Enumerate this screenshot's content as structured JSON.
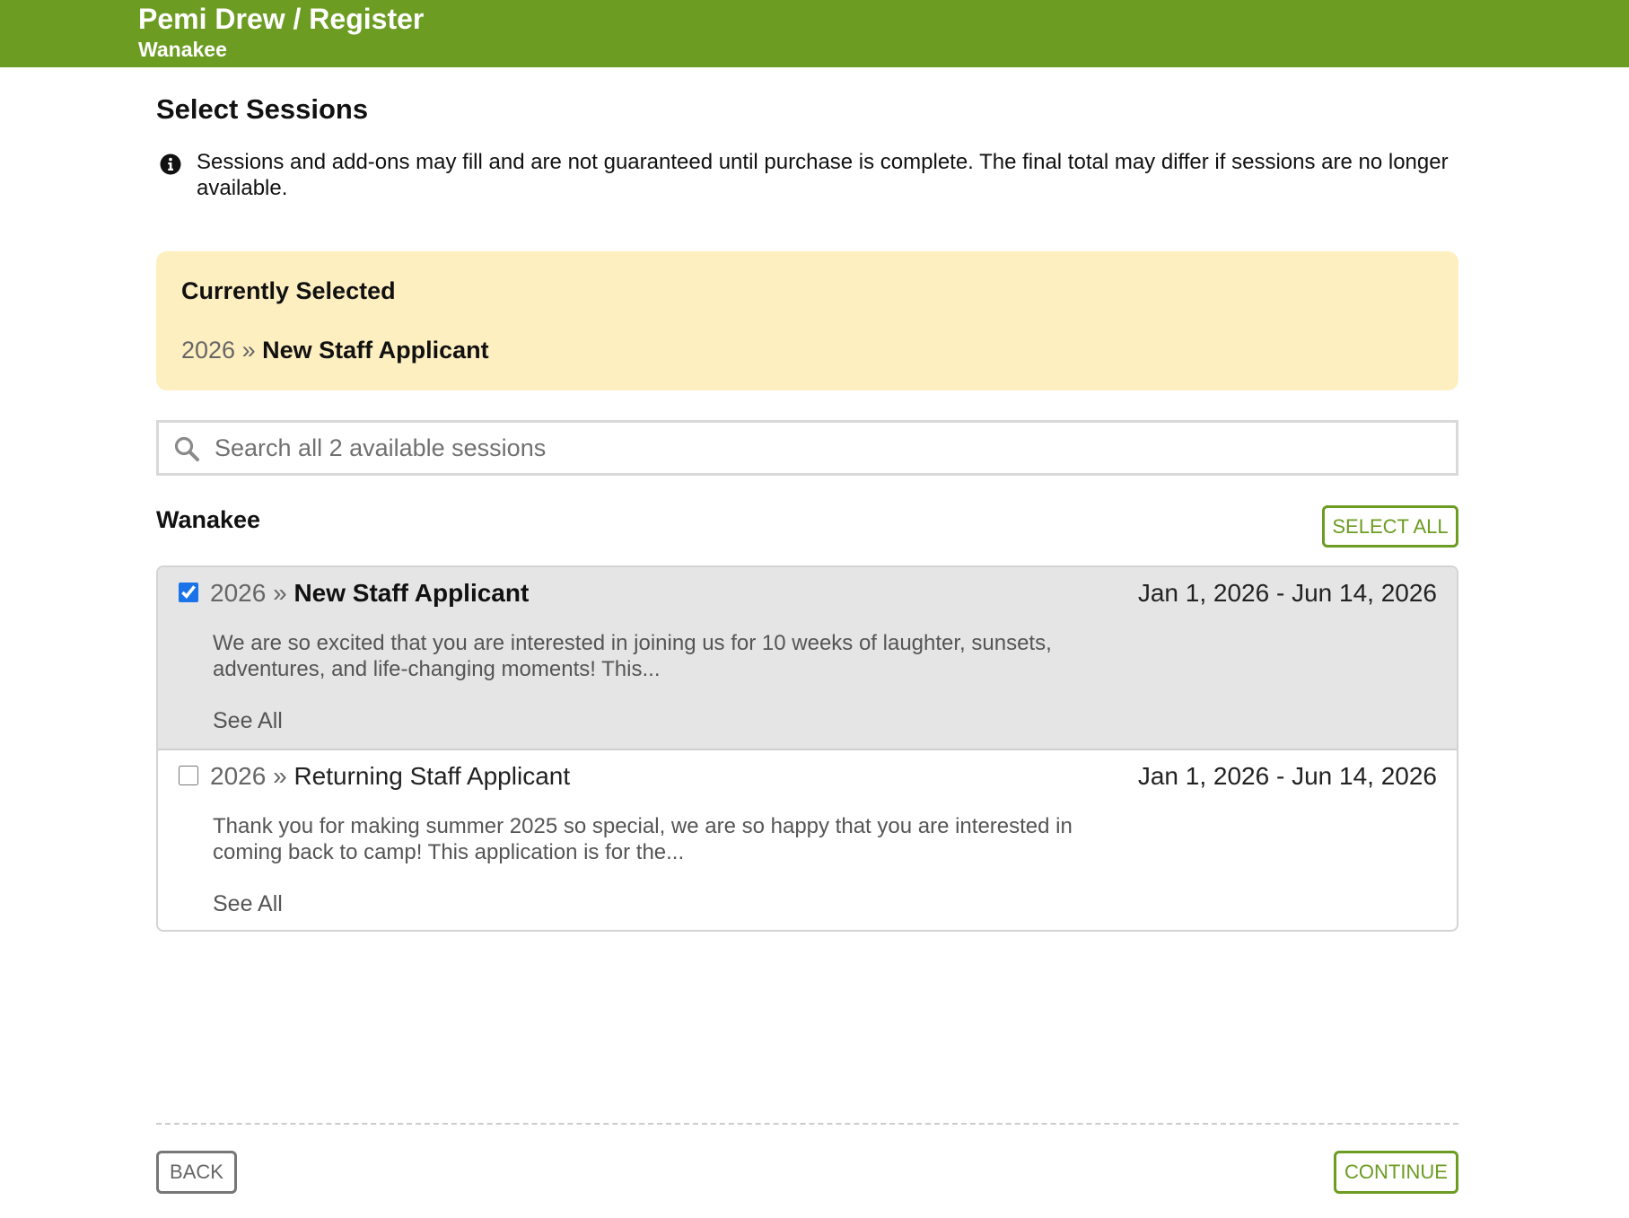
{
  "header": {
    "title": "Pemi Drew / Register",
    "subtitle": "Wanakee",
    "color": "#6c9c22"
  },
  "page": {
    "title": "Select Sessions",
    "notice": "Sessions and add-ons may fill and are not guaranteed until purchase is complete. The final total may differ if sessions are no longer available.",
    "notice_icon": "info-circle-icon"
  },
  "currently_selected": {
    "heading": "Currently Selected",
    "year": "2026",
    "separator": "»",
    "name": "New Staff Applicant"
  },
  "search": {
    "placeholder": "Search all 2 available sessions",
    "value": "",
    "icon": "search-icon"
  },
  "section": {
    "title": "Wanakee",
    "select_all_label": "SELECT ALL"
  },
  "sessions": [
    {
      "year": "2026",
      "separator": "»",
      "name": "New Staff Applicant",
      "dates": "Jan 1, 2026 - Jun 14, 2026",
      "description": "We are so excited that you are interested in joining us for 10 weeks of laughter, sunsets, adventures, and life-changing moments! This...",
      "see_all": "See All",
      "checked": true
    },
    {
      "year": "2026",
      "separator": "»",
      "name": "Returning Staff Applicant",
      "dates": "Jan 1, 2026 - Jun 14, 2026",
      "description": "Thank you for making summer 2025 so special, we are so happy that you are interested in coming back to camp! This application is for the...",
      "see_all": "See All",
      "checked": false
    }
  ],
  "footer": {
    "back_label": "BACK",
    "continue_label": "CONTINUE"
  }
}
